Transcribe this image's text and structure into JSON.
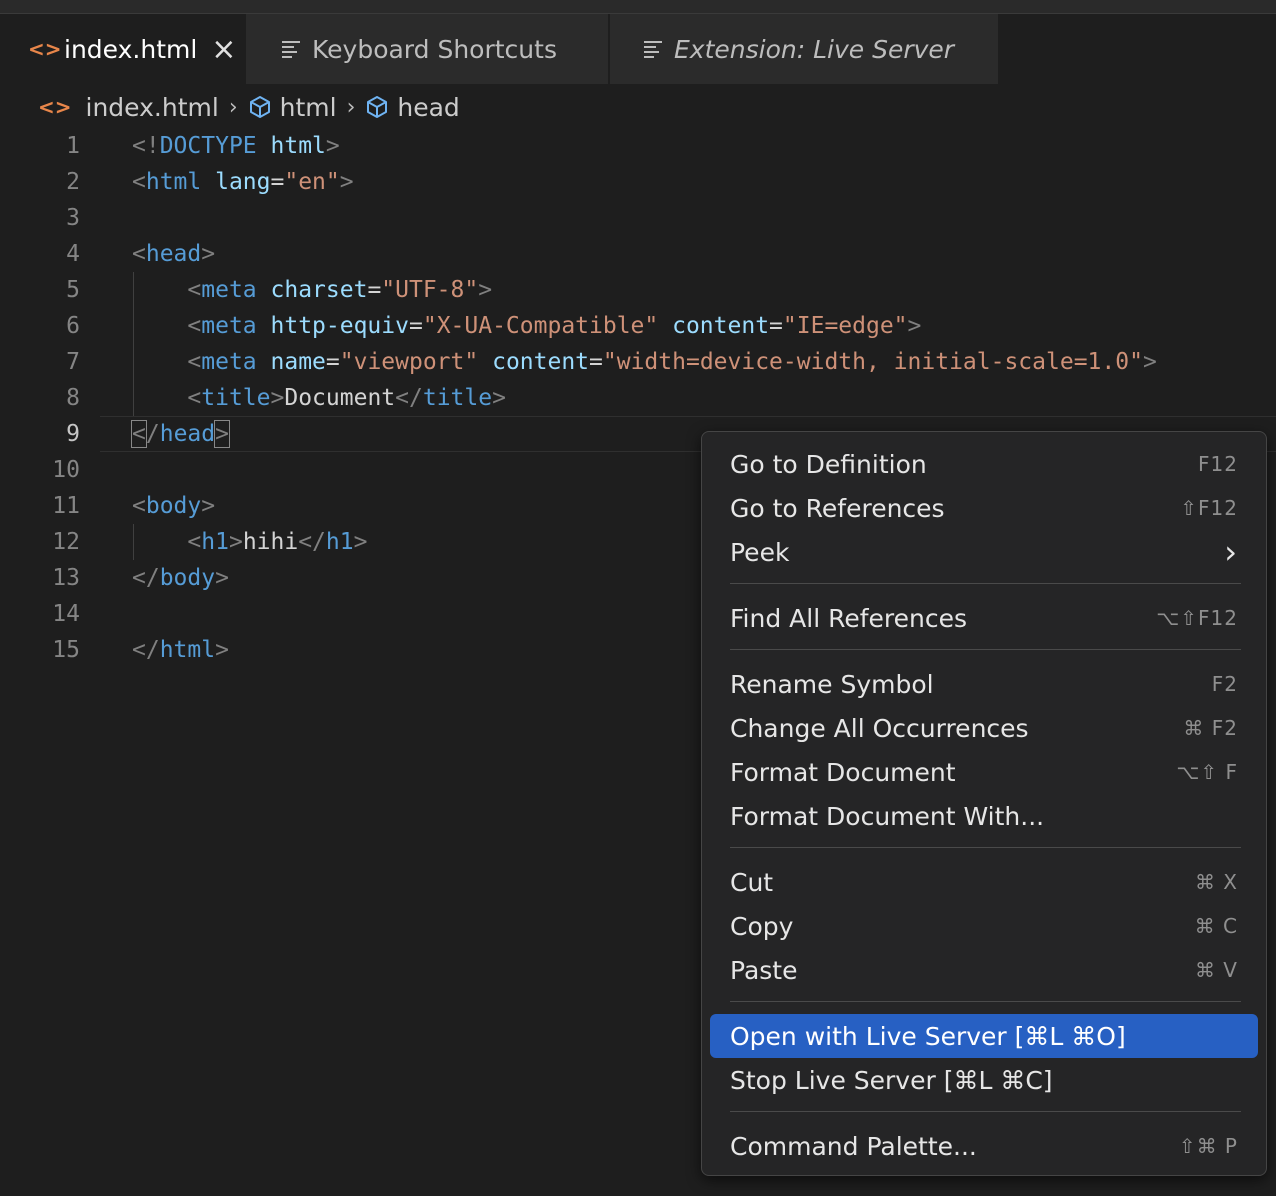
{
  "tabs": [
    {
      "label": "index.html",
      "active": true,
      "icon": "code-bracket-icon"
    },
    {
      "label": "Keyboard Shortcuts",
      "active": false,
      "icon": "list-lines-icon"
    },
    {
      "label": "Extension: Live Server",
      "active": false,
      "icon": "list-lines-icon"
    }
  ],
  "tab_close_symbol": "×",
  "breadcrumb": {
    "file": "index.html",
    "items": [
      "html",
      "head"
    ]
  },
  "editor": {
    "current_line": 9,
    "line_numbers": [
      "1",
      "2",
      "3",
      "4",
      "5",
      "6",
      "7",
      "8",
      "9",
      "10",
      "11",
      "12",
      "13",
      "14",
      "15"
    ]
  },
  "context_menu": {
    "items": [
      {
        "label": "Go to Definition",
        "shortcut": "F12"
      },
      {
        "label": "Go to References",
        "shortcut": "⇧F12"
      },
      {
        "label": "Peek",
        "shortcut": "›"
      },
      {
        "label": "Find All References",
        "shortcut": "⌥⇧F12"
      },
      {
        "label": "Rename Symbol",
        "shortcut": "F2"
      },
      {
        "label": "Change All Occurrences",
        "shortcut": "⌘ F2"
      },
      {
        "label": "Format Document",
        "shortcut": "⌥⇧ F"
      },
      {
        "label": "Format Document With...",
        "shortcut": ""
      },
      {
        "label": "Cut",
        "shortcut": "⌘ X"
      },
      {
        "label": "Copy",
        "shortcut": "⌘ C"
      },
      {
        "label": "Paste",
        "shortcut": "⌘ V"
      },
      {
        "label": "Open with Live Server [⌘L ⌘O]",
        "shortcut": "",
        "highlighted": true
      },
      {
        "label": "Stop Live Server [⌘L ⌘C]",
        "shortcut": ""
      },
      {
        "label": "Command Palette...",
        "shortcut": "⇧⌘ P"
      }
    ]
  },
  "colors": {
    "accent_highlight": "#2760c3",
    "tag": "#569cd6",
    "attribute": "#9cdcfe",
    "string": "#ce9178",
    "file_icon": "#e8864a"
  }
}
